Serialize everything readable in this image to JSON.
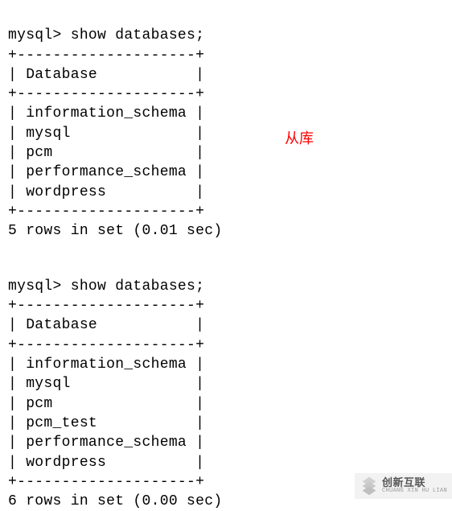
{
  "block1": {
    "prompt": "mysql> show databases;",
    "divTop": "+--------------------+",
    "header": "| Database           |",
    "divMid": "+--------------------+",
    "row0": "| information_schema |",
    "row1": "| mysql              |",
    "row2": "| pcm                |",
    "row3": "| performance_schema |",
    "row4": "| wordpress          |",
    "divBot": "+--------------------+",
    "result": "5 rows in set (0.01 sec)"
  },
  "block2": {
    "prompt": "mysql> show databases;",
    "divTop": "+--------------------+",
    "header": "| Database           |",
    "divMid": "+--------------------+",
    "row0": "| information_schema |",
    "row1": "| mysql              |",
    "row2": "| pcm                |",
    "row3": "| pcm_test           |",
    "row4": "| performance_schema |",
    "row5": "| wordpress          |",
    "divBot": "+--------------------+",
    "result": "6 rows in set (0.00 sec)"
  },
  "annotation": "从库",
  "watermark": {
    "cn": "创新互联",
    "en": "CHUANG XIN HU LIAN"
  }
}
